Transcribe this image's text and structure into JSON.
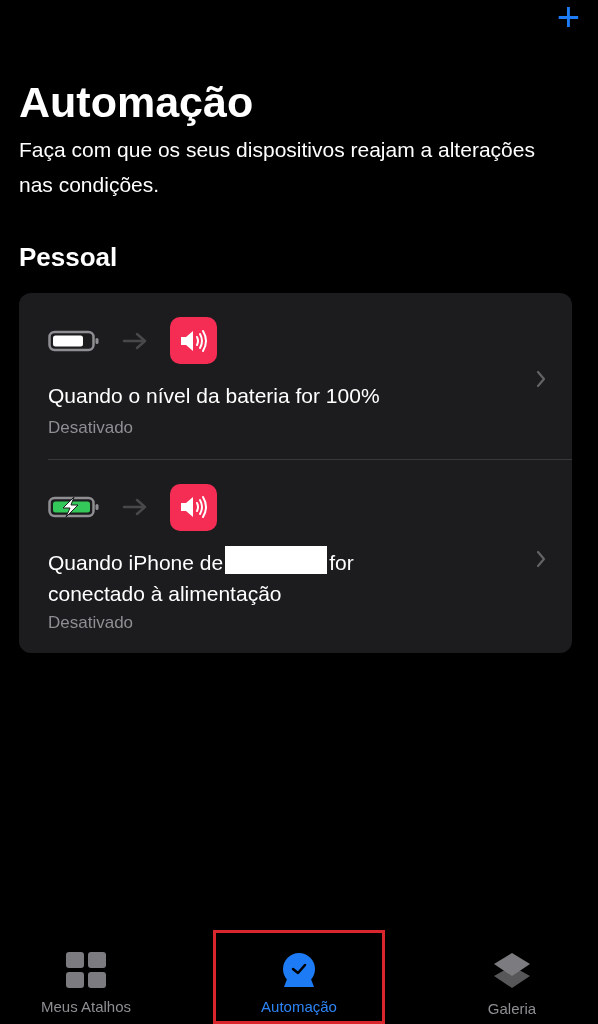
{
  "header": {
    "add_button": "+",
    "title": "Automação",
    "subtitle": "Faça com que os seus dispositivos reajam a alterações nas condições."
  },
  "section": {
    "title": "Pessoal",
    "automations": [
      {
        "kind": "battery-full",
        "title": "Quando o nível da bateria for 100%",
        "redacted": false,
        "status": "Desativado"
      },
      {
        "kind": "battery-charging",
        "title": "Quando iPhone de",
        "redacted": true,
        "title_after": "for",
        "title_line2": "conectado à alimentação",
        "status": "Desativado"
      }
    ]
  },
  "tab_bar": [
    {
      "kind": "grid",
      "label": "Meus Atalhos",
      "selected": false,
      "highlighted": false
    },
    {
      "kind": "clock",
      "label": "Automação",
      "selected": true,
      "highlighted": true
    },
    {
      "kind": "layers",
      "label": "Galeria",
      "selected": false,
      "highlighted": false
    }
  ]
}
